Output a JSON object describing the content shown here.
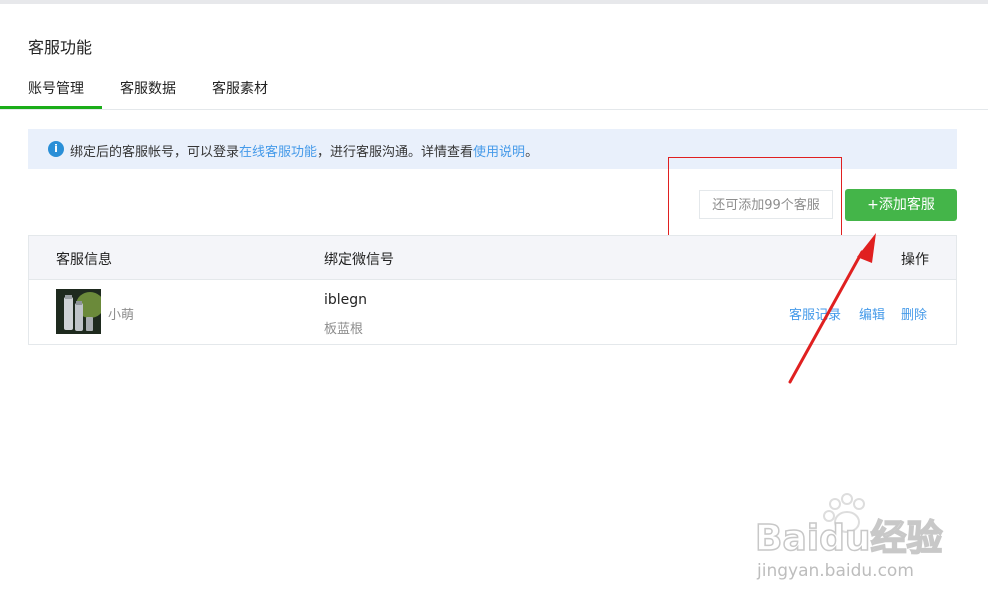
{
  "page": {
    "title": "客服功能"
  },
  "tabs": [
    {
      "label": "账号管理",
      "active": true
    },
    {
      "label": "客服数据",
      "active": false
    },
    {
      "label": "客服素材",
      "active": false
    }
  ],
  "notice": {
    "icon": "info-icon",
    "text_before": "绑定后的客服帐号，可以登录",
    "link1": "在线客服功能",
    "text_middle": "，进行客服沟通。详情查看",
    "link2": "使用说明",
    "text_after": "。"
  },
  "toolbar": {
    "quota_text": "还可添加99个客服",
    "add_button": "+添加客服"
  },
  "table": {
    "headers": {
      "info": "客服信息",
      "wechat": "绑定微信号",
      "actions": "操作"
    },
    "rows": [
      {
        "nickname": "小萌",
        "wechat_id": "iblegn",
        "wechat_name": "板蓝根",
        "actions": {
          "records": "客服记录",
          "edit": "编辑",
          "delete": "删除"
        }
      }
    ]
  },
  "watermark": {
    "line1": "Baidu经验",
    "line2": "jingyan.baidu.com"
  },
  "colors": {
    "accent_green": "#44b549",
    "link_blue": "#459ae9",
    "annotation_red": "#e02020"
  }
}
